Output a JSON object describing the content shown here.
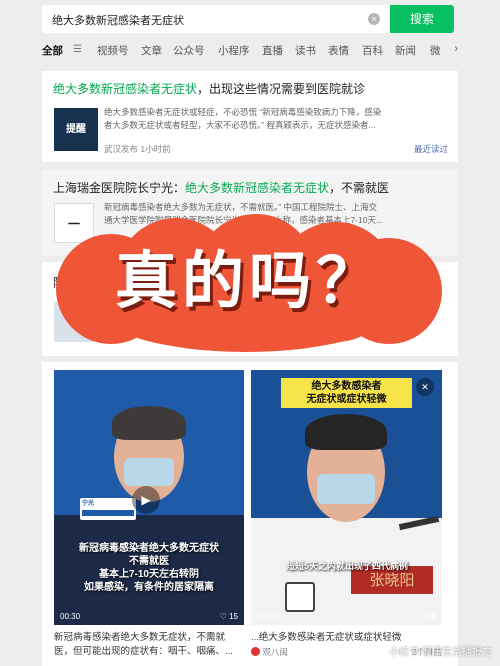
{
  "search": {
    "query": "绝大多数新冠感染者无症状",
    "button": "搜索",
    "clear_icon": "close-icon"
  },
  "tabs": [
    "全部",
    "视频号",
    "文章",
    "公众号",
    "小程序",
    "直播",
    "读书",
    "表情",
    "百科",
    "新闻",
    "微"
  ],
  "result1": {
    "title_highlight": "绝大多数新冠感染者无症状",
    "title_rest": "，出现这些情况需要到医院就诊",
    "snippet_line1": "绝大多数感染者无症状或轻症，不必恐慌 “新冠病毒感染致病力下降，感染",
    "snippet_line2": "者大多数无症状或者轻型，大家不必恐慌。” 程真颖表示，无症状感染者...",
    "thumb": "提醒",
    "source": "武汉发布 1小时前",
    "recent": "最近读过"
  },
  "result2": {
    "title_prefix": "上海瑞金医院院长宁光：",
    "title_highlight": "绝大多数新冠感染者无症状",
    "title_rest": "，不需就医",
    "snippet_line1": "新冠病毒感染者绝大多数为无症状，不需就医。” 中国工程院院士、上海交",
    "snippet_line2": "通大学医学院附属瑞金医院院长宁光在发布会上称，感染者基本上7-10天..."
  },
  "overlay": {
    "text": "真的吗？"
  },
  "video1": {
    "caption": [
      "新冠病毒感染者绝大多数无症状",
      "不需就医",
      "基本上7-10天左右转阴",
      "如果感染，有条件的居家隔离"
    ],
    "name_tag": "宁光",
    "duration": "00:30",
    "likes": "15",
    "desc_line1": "新冠病毒感染者绝大多数无症状，不需就",
    "desc_line2": "医，但可能出现的症状有：咽干、咽痛、..."
  },
  "video2": {
    "banner": [
      "绝大多数感染者",
      "无症状或症状轻微"
    ],
    "subtitle": "短短5天之内就出现了四代病例",
    "name_plate": "张晓阳",
    "duration": "00:30",
    "likes": "58",
    "desc_line1": "...绝大多数感染者无症状或症状轻微",
    "desc_line2": "观八闽",
    "time": "2个月前"
  },
  "watermark": "小红书 健康生活播报方",
  "colors": {
    "accent": "#07c160",
    "overlay": "#ef5638"
  }
}
